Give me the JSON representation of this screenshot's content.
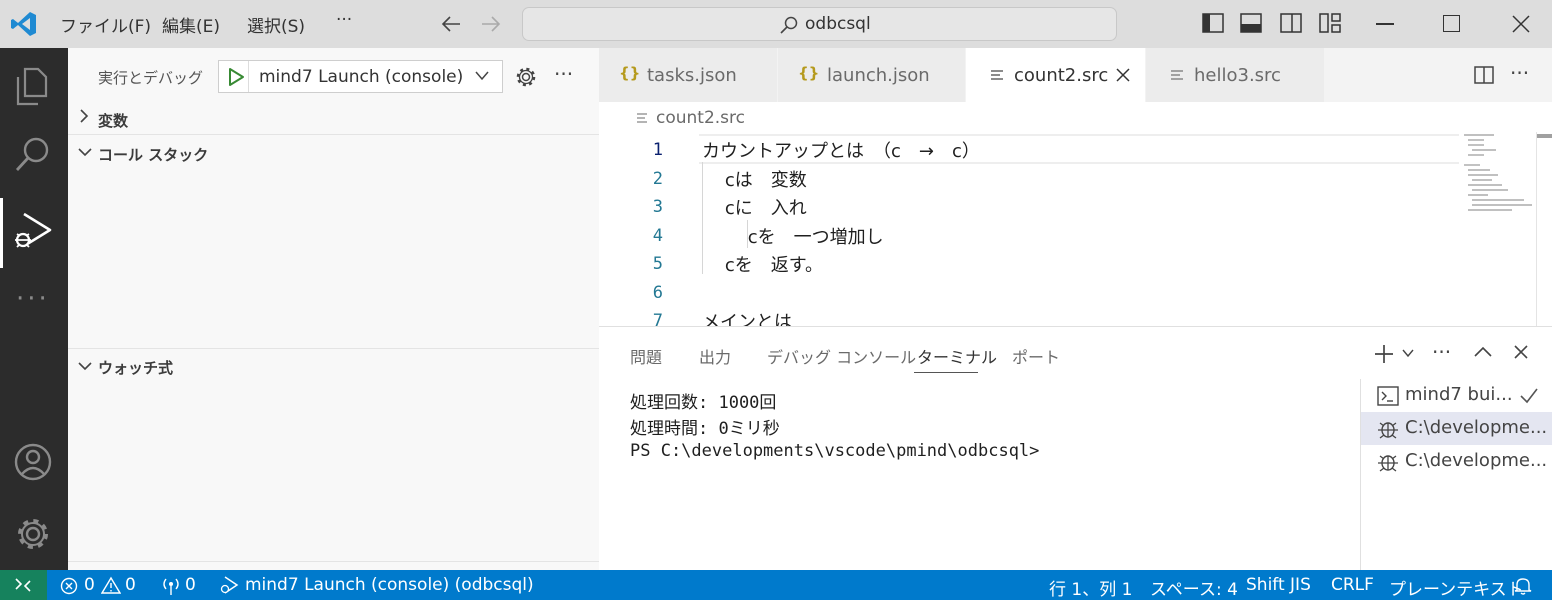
{
  "titlebar": {
    "menus": [
      "ファイル(F)",
      "編集(E)",
      "選択(S)",
      "···"
    ],
    "search": "odbcsql"
  },
  "sidebar": {
    "run_title": "実行とデバッグ",
    "launch_config": "mind7 Launch (console)",
    "sections": {
      "variables": "変数",
      "callstack": "コール スタック",
      "watch": "ウォッチ式"
    }
  },
  "tabs": [
    {
      "label": "tasks.json",
      "icon": "json-braces-icon"
    },
    {
      "label": "launch.json",
      "icon": "json-braces-icon"
    },
    {
      "label": "count2.src",
      "icon": "text-file-icon",
      "active": true
    },
    {
      "label": "hello3.src",
      "icon": "text-file-icon"
    }
  ],
  "editor": {
    "breadcrumb": "count2.src",
    "lines": [
      {
        "n": "1",
        "text": "カウントアップとは　（c　→　c）"
      },
      {
        "n": "2",
        "text": "    cは　変数"
      },
      {
        "n": "3",
        "text": "    cに　入れ"
      },
      {
        "n": "4",
        "text": "        cを　一つ増加し"
      },
      {
        "n": "5",
        "text": "    cを　返す。"
      },
      {
        "n": "6",
        "text": ""
      },
      {
        "n": "7",
        "text": "メインとは"
      }
    ]
  },
  "panel": {
    "tabs": [
      "問題",
      "出力",
      "デバッグ コンソール",
      "ターミナル",
      "ポート"
    ],
    "active_tab": "ターミナル",
    "terminal_lines": [
      "処理回数: 1000回",
      "処理時間: 0ミリ秒",
      "PS C:\\developments\\vscode\\pmind\\odbcsql>"
    ],
    "terminals": [
      {
        "label": "mind7 bui...",
        "icon": "terminal-icon"
      },
      {
        "label": "C:\\developme...",
        "icon": "debug-icon"
      },
      {
        "label": "C:\\developme...",
        "icon": "debug-icon"
      }
    ]
  },
  "status": {
    "errors": "0",
    "warnings": "0",
    "ports": "0",
    "debug": "mind7 Launch (console) (odbcsql)",
    "position": "行 1、列 1",
    "spaces": "スペース: 4",
    "encoding": "Shift JIS",
    "eol": "CRLF",
    "language": "プレーンテキスト"
  },
  "colors": {
    "accent": "#007acc",
    "activity_bg": "#2c2c2c",
    "remote": "#16825d"
  }
}
